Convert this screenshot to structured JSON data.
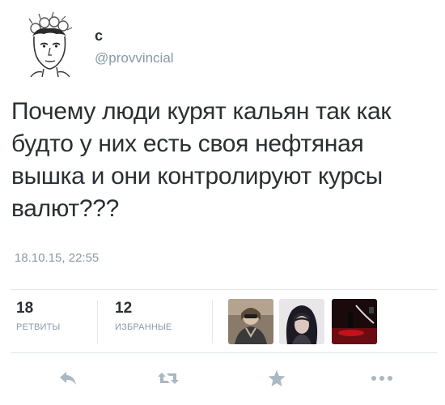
{
  "author": {
    "display_name": "c",
    "handle": "@provvincial"
  },
  "tweet": {
    "text": "Почему люди курят кальян так как будто у них есть своя нефтяная вышка и они контролируют курсы валют???",
    "timestamp": "18.10.15, 22:55"
  },
  "stats": {
    "retweets_count": "18",
    "retweets_label": "РЕТВИТЫ",
    "favorites_count": "12",
    "favorites_label": "ИЗБРАННЫЕ"
  },
  "colors": {
    "text": "#292f33",
    "muted": "#8899a6",
    "divider": "#e1e8ed"
  },
  "actions": [
    "reply-icon",
    "retweet-icon",
    "favorite-icon",
    "more-icon"
  ]
}
